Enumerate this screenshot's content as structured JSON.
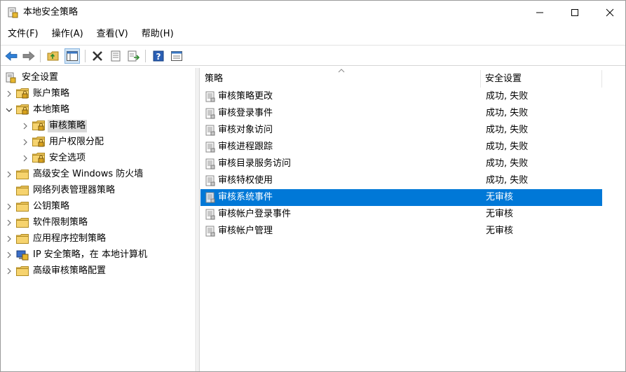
{
  "window": {
    "title": "本地安全策略"
  },
  "menu": {
    "items": [
      "文件(F)",
      "操作(A)",
      "查看(V)",
      "帮助(H)"
    ]
  },
  "toolbar": {
    "buttons": [
      "back-icon",
      "forward-icon",
      "up-folder-icon",
      "show-hide-tree-icon",
      "delete-icon",
      "properties-icon",
      "export-list-icon",
      "help-icon",
      "view-icon"
    ]
  },
  "tree": {
    "root": "安全设置",
    "items": [
      {
        "label": "账户策略",
        "level": 1,
        "expanded": false
      },
      {
        "label": "本地策略",
        "level": 1,
        "expanded": true
      },
      {
        "label": "审核策略",
        "level": 2,
        "expanded": false,
        "selected": true
      },
      {
        "label": "用户权限分配",
        "level": 2,
        "expanded": false
      },
      {
        "label": "安全选项",
        "level": 2,
        "expanded": false
      },
      {
        "label": "高级安全 Windows 防火墙",
        "level": 1,
        "expanded": false
      },
      {
        "label": "网络列表管理器策略",
        "level": 1,
        "expanded": false
      },
      {
        "label": "公钥策略",
        "level": 1,
        "expanded": false
      },
      {
        "label": "软件限制策略",
        "level": 1,
        "expanded": false
      },
      {
        "label": "应用程序控制策略",
        "level": 1,
        "expanded": false
      },
      {
        "label": "IP 安全策略，在 本地计算机",
        "level": 1,
        "expanded": false
      },
      {
        "label": "高级审核策略配置",
        "level": 1,
        "expanded": false
      }
    ]
  },
  "list": {
    "columns": [
      "策略",
      "安全设置"
    ],
    "rows": [
      {
        "name": "审核策略更改",
        "setting": "成功, 失败"
      },
      {
        "name": "审核登录事件",
        "setting": "成功, 失败"
      },
      {
        "name": "审核对象访问",
        "setting": "成功, 失败"
      },
      {
        "name": "审核进程跟踪",
        "setting": "成功, 失败"
      },
      {
        "name": "审核目录服务访问",
        "setting": "成功, 失败"
      },
      {
        "name": "审核特权使用",
        "setting": "成功, 失败"
      },
      {
        "name": "审核系统事件",
        "setting": "无审核",
        "selected": true
      },
      {
        "name": "审核帐户登录事件",
        "setting": "无审核"
      },
      {
        "name": "审核帐户管理",
        "setting": "无审核"
      }
    ]
  },
  "colors": {
    "selection": "#0078d7",
    "tree_selection": "#d9d9d9",
    "folder": "#e8c15a"
  }
}
